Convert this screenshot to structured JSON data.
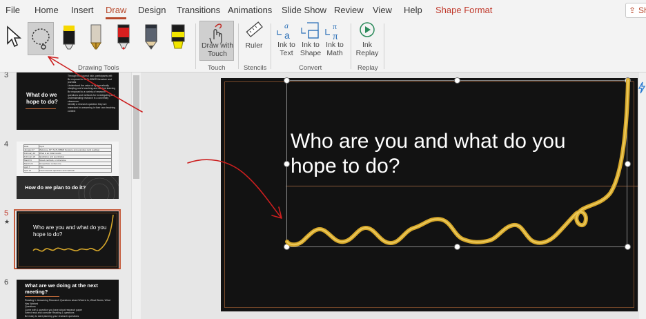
{
  "tabs": [
    "File",
    "Home",
    "Insert",
    "Draw",
    "Design",
    "Transitions",
    "Animations",
    "Slide Show",
    "Review",
    "View",
    "Help",
    "Shape Format"
  ],
  "active_tab": "Draw",
  "share_label": "Share",
  "ribbon": {
    "drawing_tools_label": "Drawing Tools",
    "draw_with_touch_label": "Draw with Touch",
    "touch_label": "Touch",
    "ruler_label": "Ruler",
    "stencils_label": "Stencils",
    "ink_to_text_label": "Ink to Text",
    "ink_to_shape_label": "Ink to Shape",
    "ink_to_math_label": "Ink to Math",
    "convert_label": "Convert",
    "ink_replay_label": "Ink Replay",
    "replay_label": "Replay"
  },
  "pens": [
    {
      "name": "pen-black",
      "color": "#111111"
    },
    {
      "name": "pen-gold",
      "color": "#c99a2e"
    },
    {
      "name": "pen-red",
      "color": "#d61f1f"
    },
    {
      "name": "pencil-gray",
      "color": "#6b6b6b"
    },
    {
      "name": "highlighter-yellow",
      "color": "#f2e600"
    }
  ],
  "slides": [
    {
      "number": "3",
      "title": "What do we hope to do?",
      "text": [
        "Through this journal club, participants will:",
        "Be exposed to SoTL/DBER literature and journals",
        "Understand the value of systematically studying one's teaching and student learning",
        "Be exposed to a variety of research questions and methods for investigating and understanding research in a university classroom",
        "Identify a research question they are interested in answering in their own teaching context"
      ]
    },
    {
      "number": "4",
      "title": "How do we plan to do it?",
      "table_header": [
        "Date",
        "Topic"
      ],
      "table_rows": [
        [
          "January 27",
          "Welcome, DIY SoTL/DBER literature and examples (and reading)"
        ],
        [
          "February 10",
          "What is an initial results"
        ],
        [
          "February 24",
          "Qualitative and quantitative"
        ],
        [
          "March 9",
          "Mixed-methods, or otherwise"
        ],
        [
          "March 24",
          "Group/class conference"
        ],
        [
          "April 7",
          "TBA"
        ],
        [
          "April 21",
          "Final research questions and methods"
        ]
      ]
    },
    {
      "number": "5",
      "title": "Who are you and what do you hope to do?",
      "star": "★"
    },
    {
      "number": "6",
      "title": "What are we doing at the next meeting?",
      "text": [
        "Reading 1: Answering Research Questions about What is Is, What Works, What Has Worked",
        "Questions",
        "Come with 1 question you have about research paper",
        "Select read and consider Reading 1 questions",
        "Be ready to start planning your research questions"
      ]
    }
  ],
  "current_slide": {
    "title": "Who are you and what do you hope to do?"
  },
  "colors": {
    "accent": "#b7472a",
    "gold_ink": "#d6a72a",
    "red_ink": "#cc1f1f",
    "slide_bg": "#121212"
  }
}
